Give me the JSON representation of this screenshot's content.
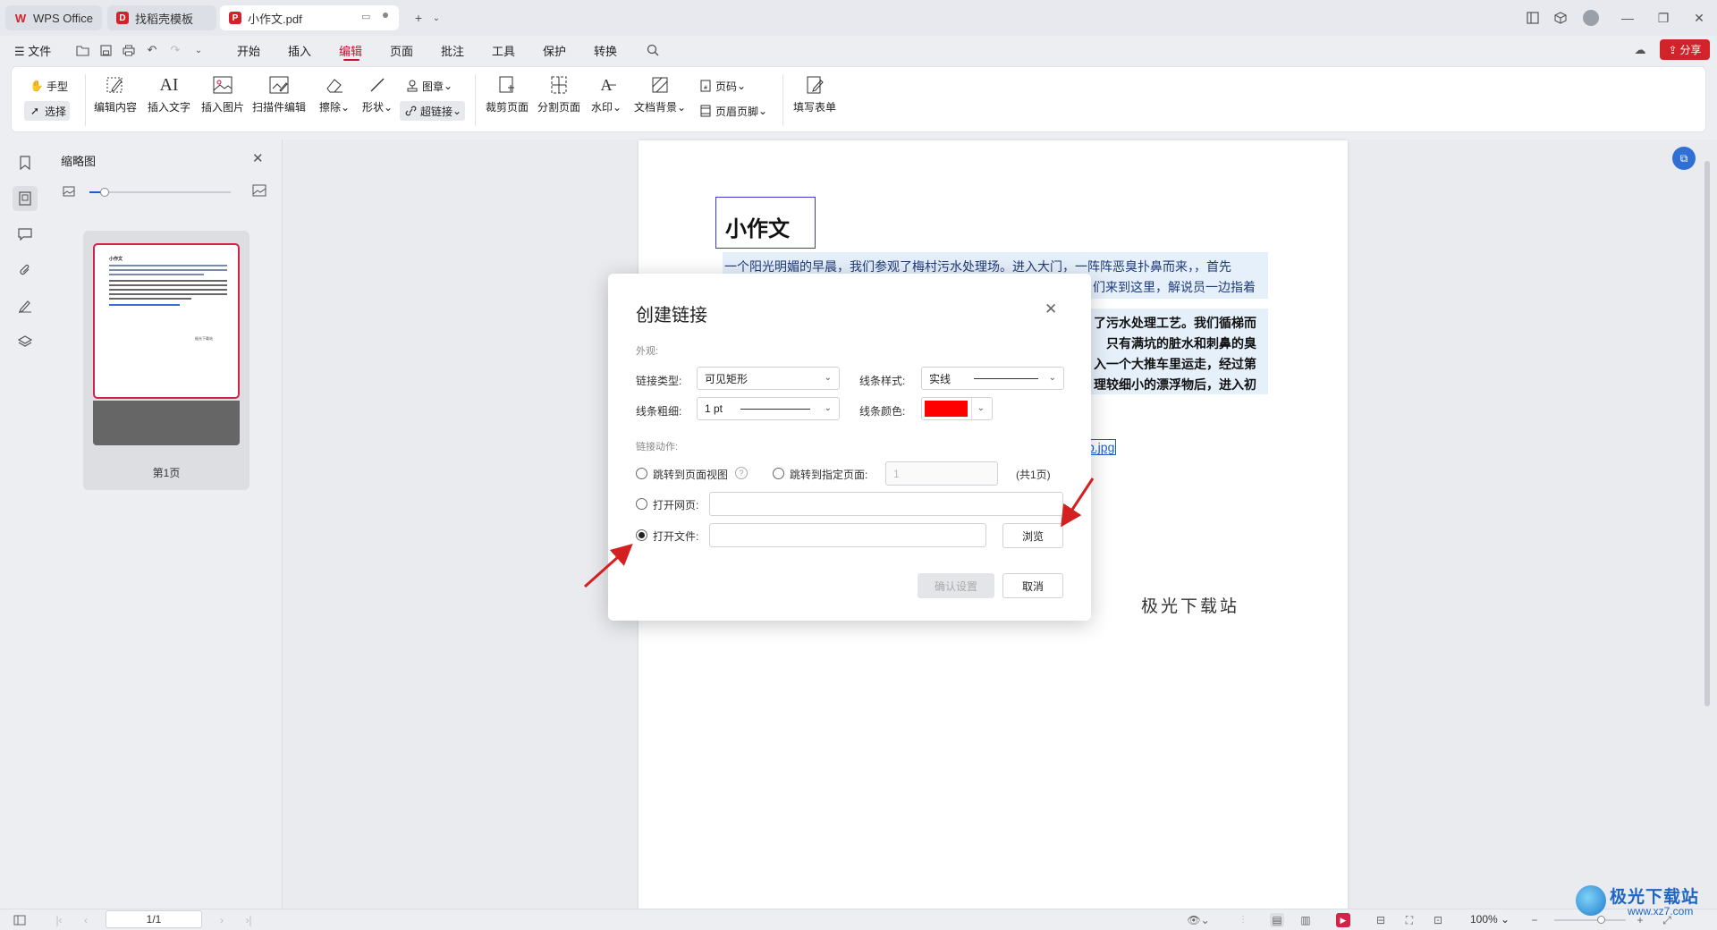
{
  "tabs": [
    {
      "label": "WPS Office",
      "icon": "wps-logo-icon"
    },
    {
      "label": "找稻壳模板",
      "icon": "docer-icon"
    },
    {
      "label": "小作文.pdf",
      "icon": "pdf-icon"
    }
  ],
  "menu": {
    "file": "文件",
    "items": [
      "开始",
      "插入",
      "编辑",
      "页面",
      "批注",
      "工具",
      "保护",
      "转换"
    ],
    "active": "编辑",
    "share": "分享"
  },
  "ribbon": {
    "hand": "手型",
    "select": "选择",
    "edit_content": "编辑内容",
    "insert_text": "插入文字",
    "insert_image": "插入图片",
    "scan_edit": "扫描件编辑",
    "erase": "擦除",
    "shape": "形状",
    "stamp": "图章",
    "hyperlink": "超链接",
    "crop_page": "裁剪页面",
    "split_page": "分割页面",
    "watermark": "水印",
    "doc_background": "文档背景",
    "page_number": "页码",
    "header_footer": "页眉页脚",
    "fill_form": "填写表单"
  },
  "thumbnail_panel": {
    "title": "缩略图",
    "page_label": "第1页",
    "zoom_level": 0.1,
    "mini_title": "小作文",
    "mini_watermark": "极光下载站"
  },
  "document": {
    "title": "小作文",
    "para1_line1": "一个阳光明媚的早晨，我们参观了梅村污水处理场。进入大门，一阵阵恶臭扑鼻而来，，首先",
    "para1_line2": "们来到这里，解说员一边指着",
    "para2_line1": "了污水处理工艺。我们循梯而",
    "para2_line2": "只有满坑的脏水和刺鼻的臭",
    "para2_line3": "入一个大推车里运走，经过第",
    "para2_line4": "理较细小的漂浮物后，进入初",
    "link_text": "b.jpg",
    "stamp_text": "极光下载站"
  },
  "dialog": {
    "title": "创建链接",
    "appearance_label": "外观:",
    "link_type_label": "链接类型:",
    "link_type_value": "可见矩形",
    "line_style_label": "线条样式:",
    "line_style_value": "实线",
    "line_width_label": "线条粗细:",
    "line_width_value": "1 pt",
    "line_color_label": "线条颜色:",
    "line_color": "#ff0000",
    "action_label": "链接动作:",
    "goto_view": "跳转到页面视图",
    "goto_page": "跳转到指定页面:",
    "page_input_placeholder": "1",
    "page_total": "(共1页)",
    "open_web": "打开网页:",
    "open_file": "打开文件:",
    "browse": "浏览",
    "confirm": "确认设置",
    "cancel": "取消"
  },
  "statusbar": {
    "page_indicator": "1/1",
    "zoom": "100%"
  },
  "watermark_logo": {
    "text": "极光下载站",
    "url": "www.xz7.com"
  },
  "colors": {
    "accent": "#c8102e",
    "link_blue": "#1a5fd0",
    "selection_bg": "#e6f0fb"
  }
}
